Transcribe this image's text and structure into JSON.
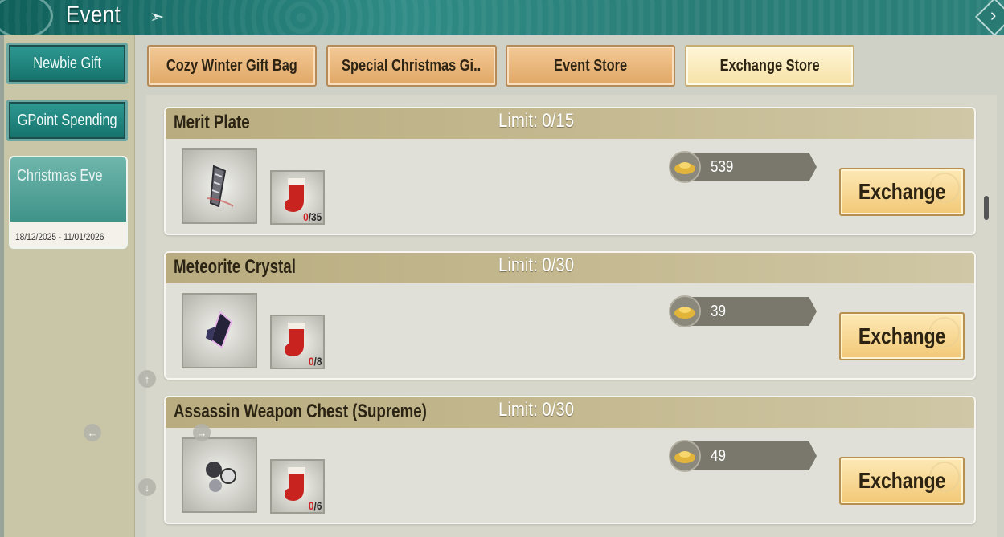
{
  "header": {
    "title": "Event"
  },
  "sidebar": {
    "items": [
      {
        "label": "Newbie Gift"
      },
      {
        "label": "GPoint Spending"
      }
    ],
    "event_card": {
      "title": "Christmas Eve",
      "dates": "18/12/2025 - 11/01/2026"
    }
  },
  "tabs": [
    {
      "label": "Cozy Winter Gift Bag",
      "active": false
    },
    {
      "label": "Special Christmas Gi..",
      "active": false
    },
    {
      "label": "Event Store",
      "active": false
    },
    {
      "label": "Exchange Store",
      "active": true
    }
  ],
  "exchange_label": "Exchange",
  "items": [
    {
      "name": "Merit Plate",
      "limit": "Limit: 0/15",
      "price": "539",
      "have": "0",
      "need": "/35",
      "icon": "merit-plate-icon"
    },
    {
      "name": "Meteorite Crystal",
      "limit": "Limit: 0/30",
      "price": "39",
      "have": "0",
      "need": "/8",
      "icon": "meteorite-crystal-icon"
    },
    {
      "name": "Assassin Weapon Chest (Supreme)",
      "limit": "Limit: 0/30",
      "price": "49",
      "have": "0",
      "need": "/6",
      "icon": "weapon-chest-icon"
    }
  ],
  "colors": {
    "teal": "#2a7d77",
    "tab": "#e0a766",
    "tab_active": "#f6e2a6",
    "row_header": "#c6bb93",
    "count_red": "#d21f1f"
  }
}
